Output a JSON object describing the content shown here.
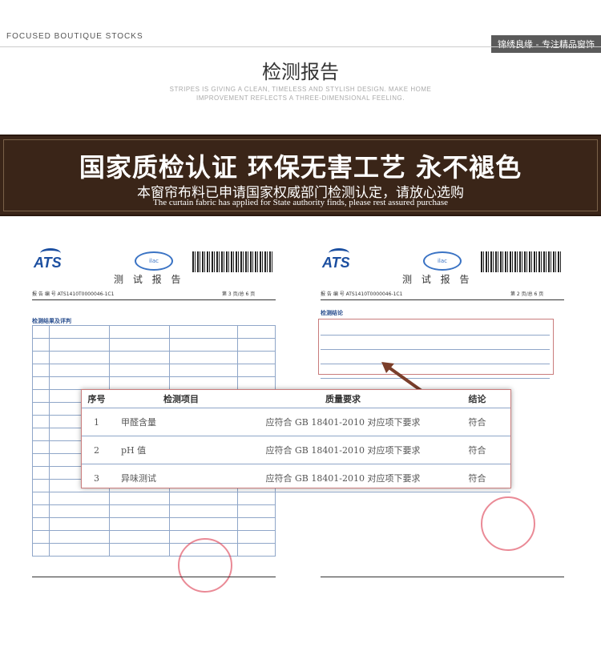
{
  "header": {
    "brand_left": "FOCUSED BOUTIQUE STOCKS",
    "brand_right": "锦绣良缘 - 专注精品窗饰"
  },
  "section": {
    "title": "检测报告",
    "subtitle_line1": "STRIPES IS GIVING A CLEAN, TIMELESS AND STYLISH DESIGN. MAKE HOME",
    "subtitle_line2": "IMPROVEMENT REFLECTS A THREE-DIMENSIONAL FEELING."
  },
  "banner": {
    "line1": "国家质检认证 环保无害工艺 永不褪色",
    "line2": "本窗帘布料已申请国家权威部门检测认定，请放心选购",
    "line3": "The curtain fabric has applied for State authority finds, please rest assured purchase"
  },
  "doc_left": {
    "logo": "ATS",
    "report_title": "测 试 报 告",
    "report_no": "报 告 编 号  ATS1410T0000046-1C1",
    "page_no": "第 3 页/总 6 页",
    "section": "检测结果及评判"
  },
  "doc_right": {
    "logo": "ATS",
    "report_title": "测 试 报 告",
    "report_no": "报 告 编 号  ATS1410T0000046-1C1",
    "page_no": "第 2 页/总 6 页",
    "section": "检测结论"
  },
  "popup": {
    "headers": [
      "序号",
      "检测项目",
      "质量要求",
      "结论"
    ],
    "rows": [
      {
        "no": "1",
        "item": "甲醛含量",
        "req": "应符合 GB 18401-2010 对应项下要求",
        "result": "符合"
      },
      {
        "no": "2",
        "item": "pH 值",
        "req": "应符合 GB 18401-2010 对应项下要求",
        "result": "符合"
      },
      {
        "no": "3",
        "item": "异味测试",
        "req": "应符合 GB 18401-2010 对应项下要求",
        "result": "符合"
      }
    ]
  },
  "colors": {
    "banner_bg": "#3a2518",
    "accent_red": "#c97c7c",
    "table_line": "#8fa6c8"
  }
}
